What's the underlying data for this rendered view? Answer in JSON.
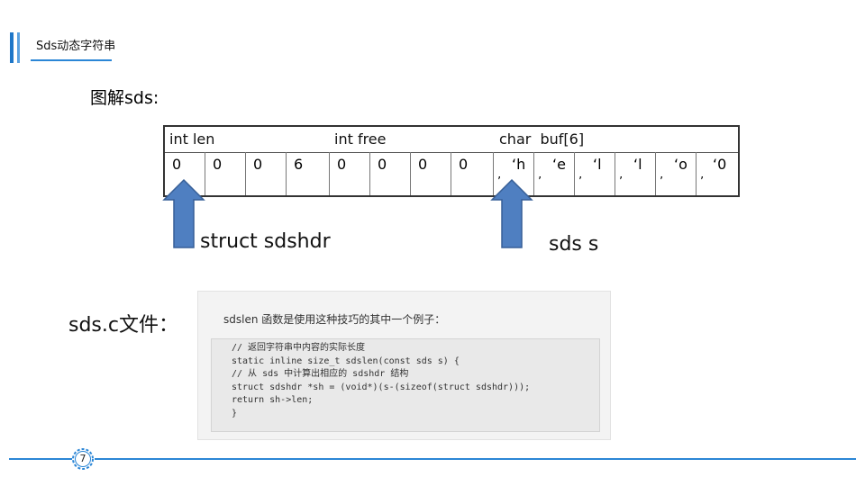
{
  "header": {
    "title": "Sds动态字符串"
  },
  "heading": "图解sds:",
  "table": {
    "headers": [
      "int len",
      "int free",
      "char  buf[6]"
    ],
    "len_values": [
      "0",
      "0",
      "0",
      "6"
    ],
    "free_values": [
      "0",
      "0",
      "0",
      "0"
    ],
    "buf_chars": [
      "‘h",
      "‘e",
      "‘l",
      "‘l",
      "‘o",
      "‘0"
    ],
    "buf_close": "’"
  },
  "labels": {
    "struct": "struct sdshdr",
    "sds": "sds s",
    "file": "sds.c文件："
  },
  "code": {
    "intro": "sdslen 函数是使用这种技巧的其中一个例子：",
    "lines": [
      "// 返回字符串中内容的实际长度",
      "static inline size_t sdslen(const sds s) {",
      "// 从 sds 中计算出相应的 sdshdr 结构",
      "struct sdshdr *sh = (void*)(s-(sizeof(struct sdshdr)));",
      "return sh->len;",
      "}"
    ]
  },
  "footer": {
    "page": "7"
  },
  "colors": {
    "accent": "#2b86d6",
    "arrow_fill": "#4f7fc1",
    "arrow_stroke": "#375f97"
  }
}
